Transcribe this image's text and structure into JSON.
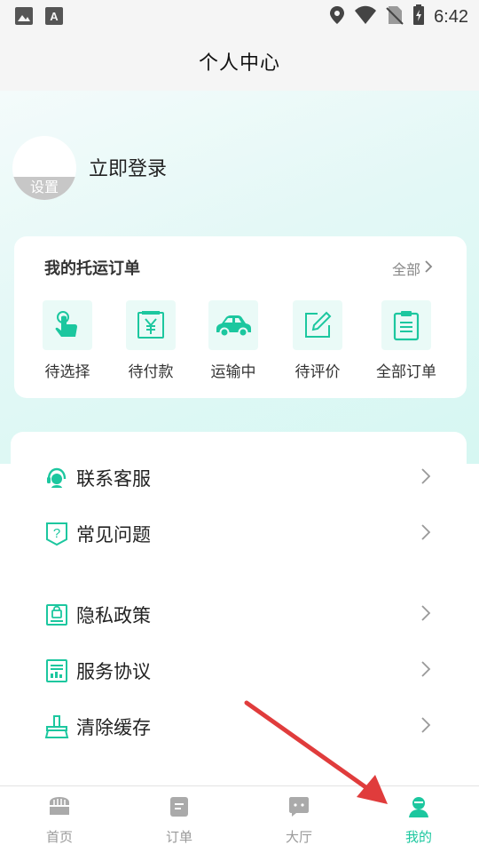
{
  "status_bar": {
    "time": "6:42",
    "left_icons": [
      "image-icon",
      "text-a-icon"
    ],
    "right_icons": [
      "location-icon",
      "wifi-icon",
      "no-sim-icon",
      "battery-charging-icon"
    ]
  },
  "header": {
    "title": "个人中心"
  },
  "profile": {
    "avatar_label": "设置",
    "login_text": "立即登录"
  },
  "orders": {
    "title": "我的托运订单",
    "all_label": "全部",
    "items": [
      {
        "label": "待选择",
        "icon": "tap-hand-icon"
      },
      {
        "label": "待付款",
        "icon": "yen-receipt-icon"
      },
      {
        "label": "运输中",
        "icon": "car-icon"
      },
      {
        "label": "待评价",
        "icon": "edit-icon"
      },
      {
        "label": "全部订单",
        "icon": "clipboard-icon"
      }
    ]
  },
  "menu": {
    "items": [
      {
        "label": "联系客服",
        "icon": "headset-icon"
      },
      {
        "label": "常见问题",
        "icon": "question-icon"
      },
      {
        "label": "隐私政策",
        "icon": "privacy-icon"
      },
      {
        "label": "服务协议",
        "icon": "agreement-icon"
      },
      {
        "label": "清除缓存",
        "icon": "brush-icon"
      }
    ]
  },
  "tab_bar": {
    "tabs": [
      {
        "label": "首页",
        "icon": "home-icon",
        "active": false
      },
      {
        "label": "订单",
        "icon": "order-icon",
        "active": false
      },
      {
        "label": "大厅",
        "icon": "hall-icon",
        "active": false
      },
      {
        "label": "我的",
        "icon": "profile-icon",
        "active": true
      }
    ]
  },
  "colors": {
    "accent": "#1cc79f",
    "inactive": "#9a9a9a",
    "annotation_arrow": "#e03c3c"
  }
}
